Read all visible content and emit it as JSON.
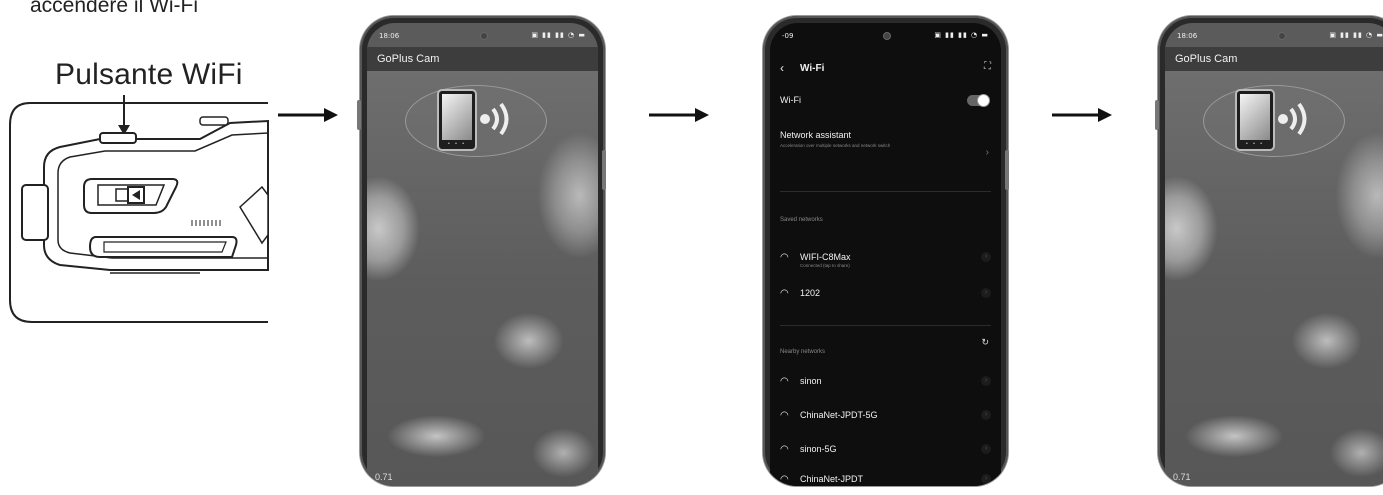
{
  "instruction": {
    "top_caption": "accendere il Wi-Fi",
    "button_caption": "Pulsante WiFi"
  },
  "phone1": {
    "status_time": "18:06",
    "app_title": "GoPlus Cam",
    "zoom_text": "0.71"
  },
  "phone2": {
    "status_time": "-09",
    "screen_title": "Wi-Fi",
    "wifi_toggle_label": "Wi-Fi",
    "network_assistant": "Network assistant",
    "network_assistant_sub": "Acceleration over multiple networks and network switch",
    "saved_section": "Saved networks",
    "saved_networks": [
      {
        "name": "WIFI-C8Max",
        "sub": "Connected (tap to share)"
      },
      {
        "name": "1202",
        "sub": ""
      }
    ],
    "nearby_section": "Nearby networks",
    "nearby_networks": [
      {
        "name": "sinon"
      },
      {
        "name": "ChinaNet-JPDT-5G"
      },
      {
        "name": "sinon-5G"
      },
      {
        "name": "ChinaNet-JPDT"
      }
    ]
  },
  "phone3": {
    "status_time": "18:06",
    "app_title": "GoPlus Cam",
    "zoom_text": "0.71"
  },
  "icons": {
    "wifi": "wifi-icon",
    "back": "back-arrow-icon",
    "scan": "scan-icon",
    "refresh": "refresh-icon",
    "chevron": "chevron-right-icon"
  }
}
